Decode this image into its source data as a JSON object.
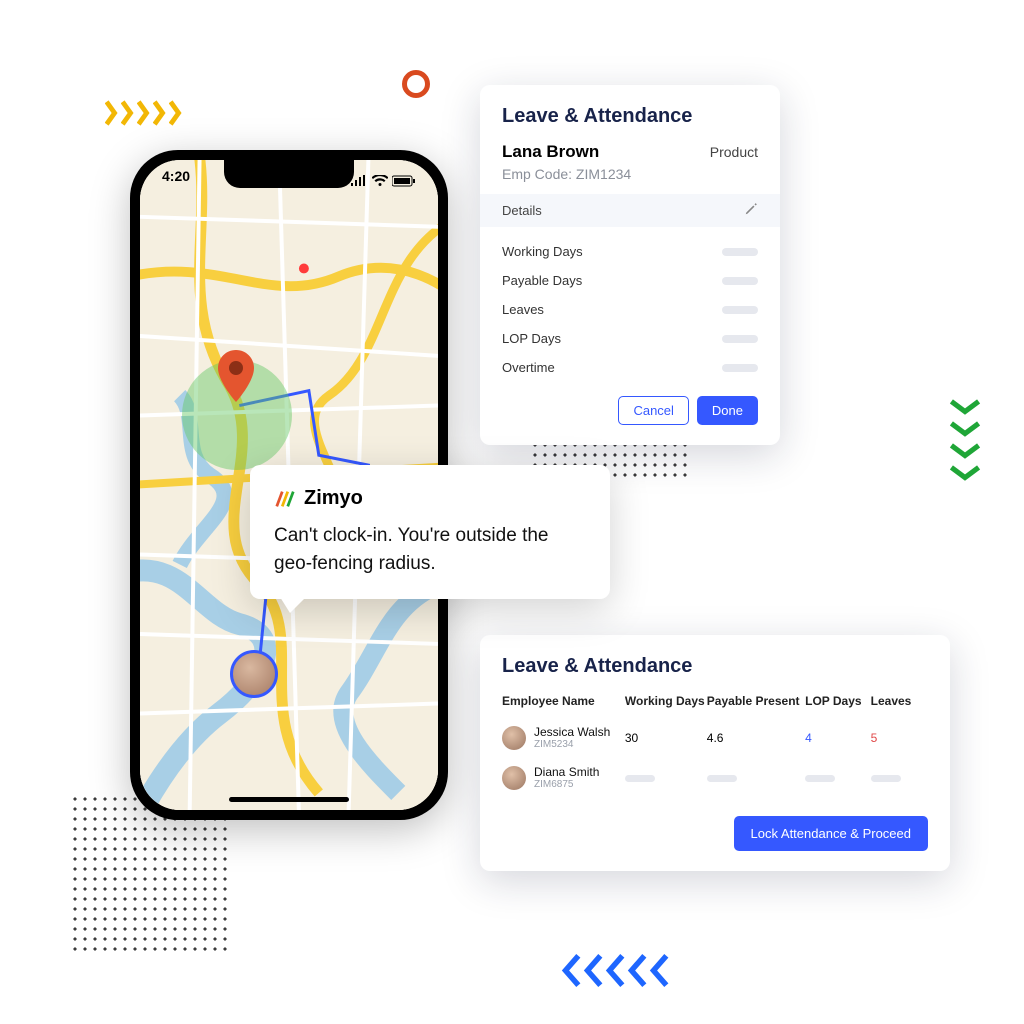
{
  "phone": {
    "time": "4:20"
  },
  "callout": {
    "brand": "Zimyo",
    "message": "Can't clock-in. You're outside the geo-fencing radius."
  },
  "card1": {
    "title": "Leave & Attendance",
    "employee_name": "Lana Brown",
    "department": "Product",
    "emp_code_label": "Emp  Code: ZIM1234",
    "details_header": "Details",
    "rows": [
      {
        "label": "Working  Days"
      },
      {
        "label": "Payable Days"
      },
      {
        "label": "Leaves"
      },
      {
        "label": "LOP Days"
      },
      {
        "label": "Overtime"
      }
    ],
    "cancel": "Cancel",
    "done": "Done"
  },
  "card2": {
    "title": "Leave & Attendance",
    "columns": {
      "c0": "Employee Name",
      "c1": "Working Days",
      "c2": "Payable Present",
      "c3": "LOP Days",
      "c4": "Leaves"
    },
    "rows": [
      {
        "name": "Jessica Walsh",
        "code": "ZIM5234",
        "working": "30",
        "payable": "4.6",
        "lop": "4",
        "leaves": "5"
      },
      {
        "name": "Diana Smith",
        "code": "ZIM6875"
      }
    ],
    "lock_btn": "Lock Attendance & Proceed"
  }
}
